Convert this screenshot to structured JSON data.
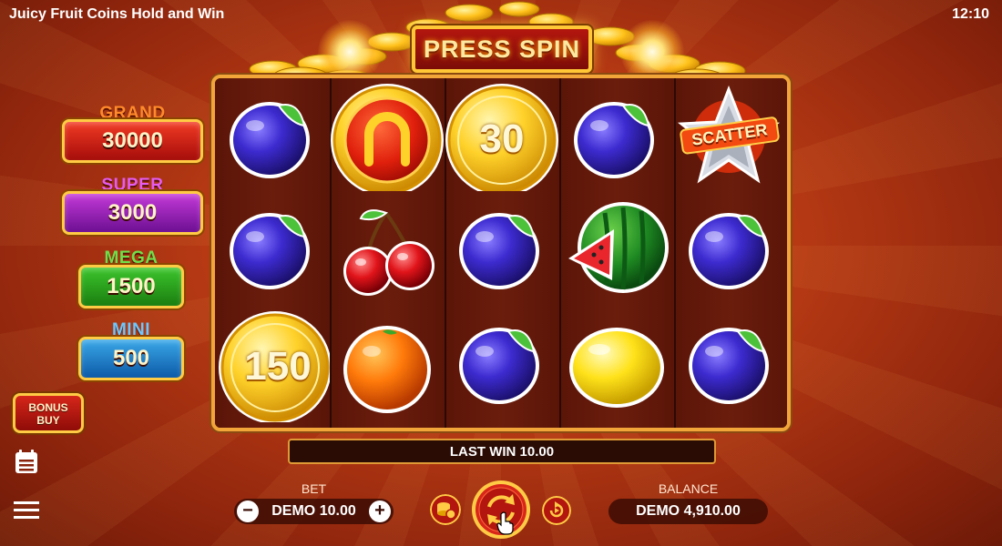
{
  "app": {
    "title": "Juicy Fruit Coins Hold and Win",
    "clock": "12:10"
  },
  "banner": {
    "press_spin": "PRESS SPIN"
  },
  "jackpots": [
    {
      "name": "GRAND",
      "value": "30000",
      "label_color": "#ff8a2a"
    },
    {
      "name": "SUPER",
      "value": "3000",
      "label_color": "#e45cf0"
    },
    {
      "name": "MEGA",
      "value": "1500",
      "label_color": "#6ee04a"
    },
    {
      "name": "MINI",
      "value": "500",
      "label_color": "#6cc8ff"
    }
  ],
  "side": {
    "bonus_buy": "BONUS\nBUY",
    "icons": [
      "paytable-icon",
      "menu-icon"
    ]
  },
  "reels": {
    "columns": [
      [
        "plum",
        "plum",
        "coin"
      ],
      [
        "horseshoe-coin",
        "cherry",
        "orange"
      ],
      [
        "coin",
        "plum",
        "plum"
      ],
      [
        "plum",
        "watermelon",
        "lemon"
      ],
      [
        "scatter",
        "plum",
        "plum"
      ]
    ],
    "coin_values": {
      "reel3_top": "30",
      "reel1_bottom": "150"
    },
    "scatter_text": "SCATTER"
  },
  "footer": {
    "last_win": "LAST WIN 10.00",
    "bet_label": "BET",
    "bet_value": "DEMO 10.00",
    "balance_label": "BALANCE",
    "balance_value": "DEMO 4,910.00"
  },
  "colors": {
    "accent_gold": "#ffcb45",
    "frame": "#f2a63a",
    "background": "#b83a14"
  }
}
